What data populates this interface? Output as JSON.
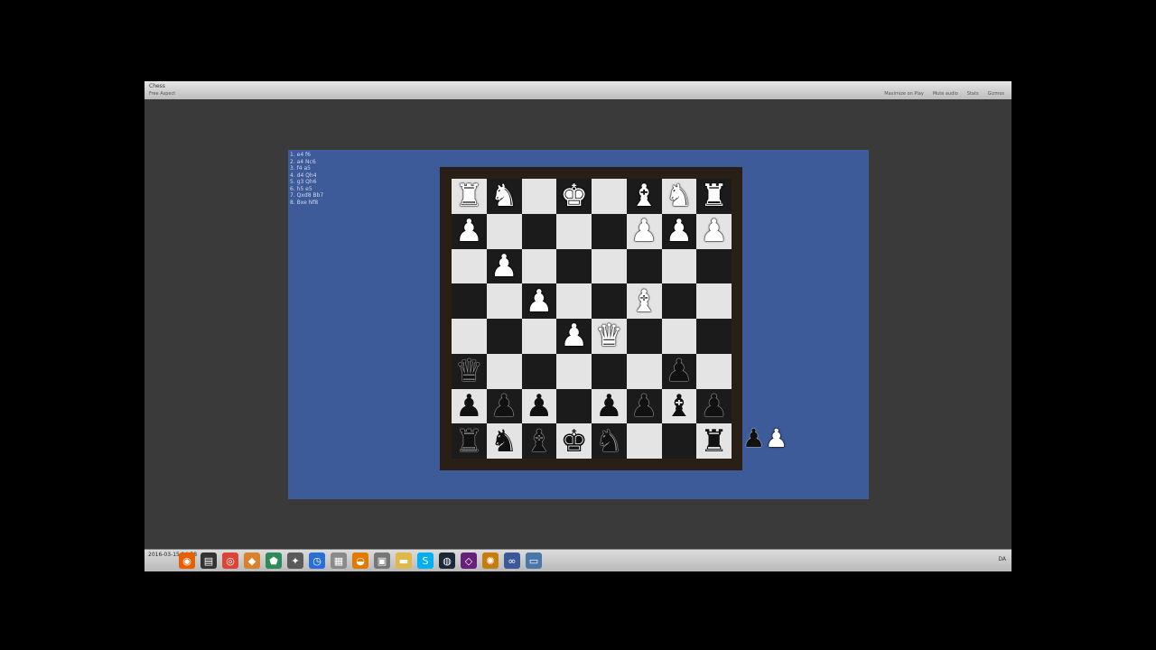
{
  "window": {
    "title": "Chess",
    "subtitle": "Free Aspect",
    "toolbar_right": [
      "Maximize on Play",
      "Mute audio",
      "Stats",
      "Gizmos"
    ]
  },
  "move_list": [
    "1. e4 f6",
    "2. a4 Nc6",
    "3. f4 a5",
    "4. d4 Qh4",
    "5. g3 Qh6",
    "6. h5 e5",
    "7. Qxd8 Bb7",
    "8. Bxe Nf8"
  ],
  "board": {
    "rows": [
      [
        "wR",
        "wN",
        "",
        "wK",
        "",
        "wB",
        "wN",
        "wR"
      ],
      [
        "wP",
        "",
        "",
        "",
        "",
        "wP",
        "wP",
        "wP"
      ],
      [
        "",
        "wP",
        "",
        "",
        "",
        "",
        "",
        ""
      ],
      [
        "",
        "",
        "wP",
        "",
        "",
        "wB",
        "",
        ""
      ],
      [
        "",
        "",
        "",
        "wP",
        "wQ",
        "",
        "",
        ""
      ],
      [
        "bQ",
        "",
        "",
        "",
        "",
        "",
        "bP",
        ""
      ],
      [
        "bP",
        "bP",
        "bP",
        "",
        "bP",
        "bP",
        "bB",
        "bP"
      ],
      [
        "bR",
        "bN",
        "bB",
        "bK",
        "bN",
        "",
        "",
        "bR"
      ]
    ]
  },
  "captured_pieces": [
    "bP",
    "wP"
  ],
  "taskbar": {
    "start_text": "2016-03-15 14:38",
    "icons": [
      {
        "name": "firefox-icon",
        "glyph": "◉",
        "color": "#e66000"
      },
      {
        "name": "notepad-icon",
        "glyph": "▤",
        "color": "#333333"
      },
      {
        "name": "chrome-icon",
        "glyph": "◎",
        "color": "#db4437"
      },
      {
        "name": "game-icon",
        "glyph": "◆",
        "color": "#d9822b"
      },
      {
        "name": "shield-icon",
        "glyph": "⬟",
        "color": "#2e8b57"
      },
      {
        "name": "tools-icon",
        "glyph": "✦",
        "color": "#5a5a5a"
      },
      {
        "name": "clock-icon",
        "glyph": "◷",
        "color": "#2a6fd6"
      },
      {
        "name": "document-icon",
        "glyph": "▦",
        "color": "#8a8a8a"
      },
      {
        "name": "headset-icon",
        "glyph": "◒",
        "color": "#e07b00"
      },
      {
        "name": "window-icon",
        "glyph": "▣",
        "color": "#777777"
      },
      {
        "name": "folder-icon",
        "glyph": "▬",
        "color": "#e0b84a"
      },
      {
        "name": "skype-icon",
        "glyph": "S",
        "color": "#00aff0"
      },
      {
        "name": "steam-icon",
        "glyph": "◍",
        "color": "#1b2838"
      },
      {
        "name": "visualstudio-icon",
        "glyph": "◇",
        "color": "#68217a"
      },
      {
        "name": "settings-icon",
        "glyph": "✺",
        "color": "#c77d0e"
      },
      {
        "name": "network-icon",
        "glyph": "∞",
        "color": "#3b5998"
      },
      {
        "name": "app-icon",
        "glyph": "▭",
        "color": "#4a76a8"
      }
    ],
    "tray_lang": "DA"
  },
  "colors": {
    "light_square": "#e4e4e4",
    "dark_square": "#1b1b1b",
    "game_background": "#3d5a99",
    "board_frame": "#2a1f17"
  }
}
